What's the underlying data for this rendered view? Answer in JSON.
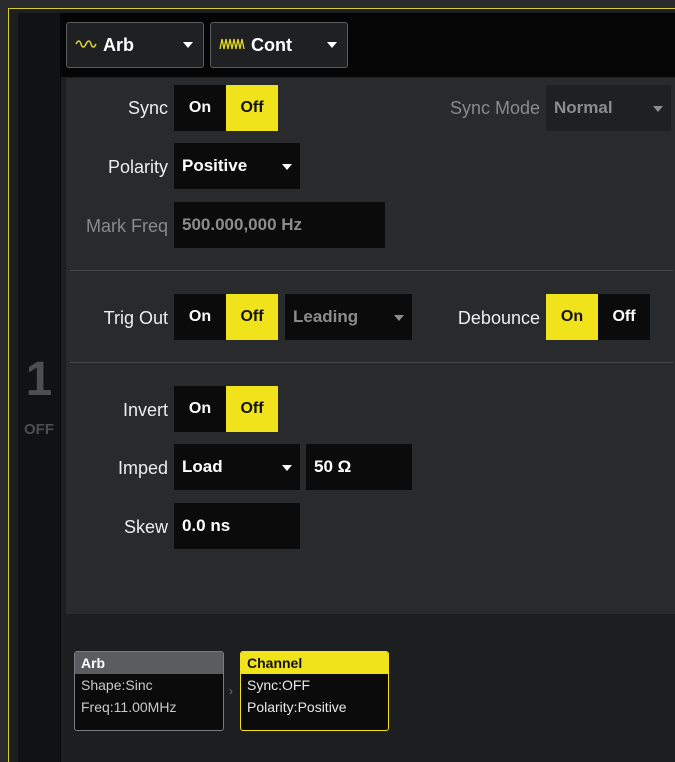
{
  "channel": {
    "number": "1",
    "state": "OFF"
  },
  "top": {
    "waveform": {
      "label": "Arb",
      "icon": "sine-wave-icon"
    },
    "mode": {
      "label": "Cont",
      "icon": "pulse-train-icon"
    }
  },
  "sync": {
    "label": "Sync",
    "on": "On",
    "off": "Off",
    "selected": "Off"
  },
  "sync_mode": {
    "label": "Sync Mode",
    "value": "Normal"
  },
  "polarity": {
    "label": "Polarity",
    "value": "Positive"
  },
  "mark_freq": {
    "label": "Mark Freq",
    "value": "500.000,000 Hz"
  },
  "trig_out": {
    "label": "Trig Out",
    "on": "On",
    "off": "Off",
    "selected": "Off",
    "edge": "Leading"
  },
  "debounce": {
    "label": "Debounce",
    "on": "On",
    "off": "Off",
    "selected": "On"
  },
  "invert": {
    "label": "Invert",
    "on": "On",
    "off": "Off",
    "selected": "Off"
  },
  "imped": {
    "label": "Imped",
    "value": "Load",
    "ohms": "50 Ω"
  },
  "skew": {
    "label": "Skew",
    "value": "0.0 ns"
  },
  "cards": {
    "arb": {
      "title": "Arb",
      "line1": "Shape:Sinc",
      "line2": "Freq:11.00MHz"
    },
    "channel": {
      "title": "Channel",
      "line1": "Sync:OFF",
      "line2": "Polarity:Positive"
    }
  },
  "colors": {
    "accent": "#f0e31c",
    "background": "#282a2c",
    "dark": "#0b0b0c"
  }
}
